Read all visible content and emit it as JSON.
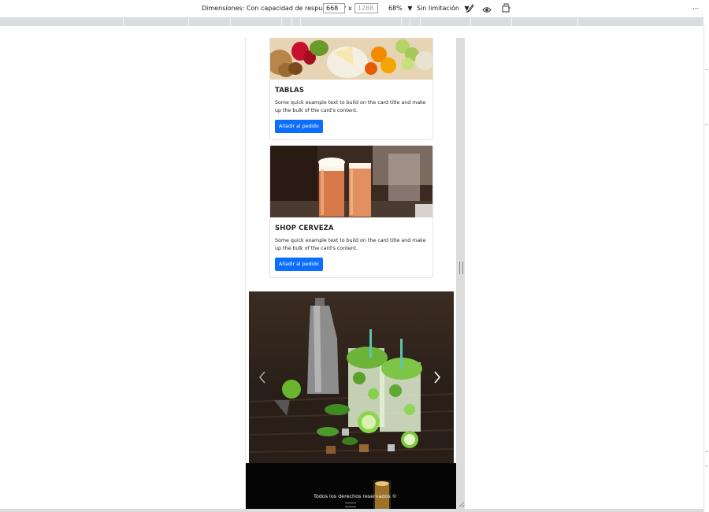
{
  "devtools": {
    "dimensions_label": "Dimensiones: Con capacidad de respuesta",
    "width_value": "668",
    "times": "x",
    "height_value": "1288",
    "zoom": "68%",
    "throttle": "Sin limitación",
    "more": "⋯"
  },
  "cards": [
    {
      "title": "TABLAS",
      "text": "Some quick example text to build on the card title and make up the bulk of the card's content.",
      "button": "Añadir al pedido"
    },
    {
      "title": "SHOP CERVEZA",
      "text": "Some quick example text to build on the card title and make up the bulk of the card's content.",
      "button": "Añadir al pedido"
    }
  ],
  "carousel": {
    "prev": "‹",
    "next": "›"
  },
  "footer": {
    "text": "Todos los derechos reservados ©"
  },
  "colors": {
    "primary_button": "#0d6efd",
    "footer_bg": "#050505",
    "toolbar_ruler": "#dadce0"
  }
}
